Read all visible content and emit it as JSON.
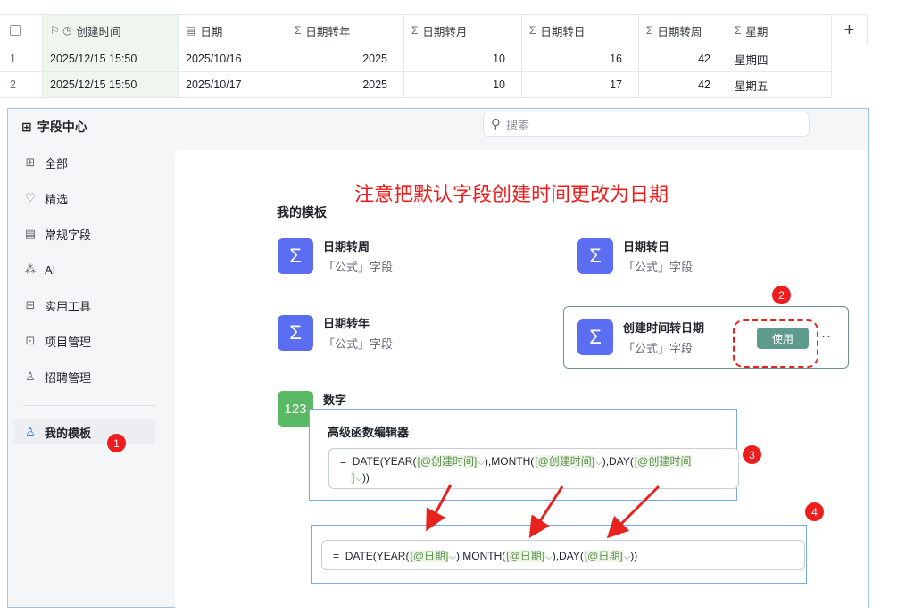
{
  "table": {
    "headers": [
      {
        "icon": "⚐ ◷",
        "label": "创建时间"
      },
      {
        "icon": "▤",
        "label": "日期"
      },
      {
        "icon": "Σ",
        "label": "日期转年"
      },
      {
        "icon": "Σ",
        "label": "日期转月"
      },
      {
        "icon": "Σ",
        "label": "日期转日"
      },
      {
        "icon": "Σ",
        "label": "日期转周"
      },
      {
        "icon": "Σ",
        "label": "星期"
      }
    ],
    "add_column": "+",
    "rows": [
      {
        "index": "1",
        "created": "2025/12/15 15:50",
        "date": "2025/10/16",
        "year": "2025",
        "month": "10",
        "day": "16",
        "week": "42",
        "weekday": "星期四"
      },
      {
        "index": "2",
        "created": "2025/12/15 15:50",
        "date": "2025/10/17",
        "year": "2025",
        "month": "10",
        "day": "17",
        "week": "42",
        "weekday": "星期五"
      }
    ]
  },
  "panel": {
    "title": "字段中心",
    "search_placeholder": "搜索",
    "nav": [
      {
        "label": "全部",
        "icon": "⊞"
      },
      {
        "label": "精选",
        "icon": "♡"
      },
      {
        "label": "常规字段",
        "icon": "▤"
      },
      {
        "label": "AI",
        "icon": "⁂"
      },
      {
        "label": "实用工具",
        "icon": "⊟"
      },
      {
        "label": "项目管理",
        "icon": "⊡"
      },
      {
        "label": "招聘管理",
        "icon": "♙"
      },
      {
        "label": "我的模板",
        "icon": "♙"
      }
    ],
    "notice": "注意把默认字段创建时间更改为日期",
    "section_title": "我的模板",
    "cards": [
      {
        "name": "日期转周",
        "sub": "「公式」字段",
        "icon": "Σ"
      },
      {
        "name": "日期转日",
        "sub": "「公式」字段",
        "icon": "Σ"
      },
      {
        "name": "日期转年",
        "sub": "「公式」字段",
        "icon": "Σ"
      },
      {
        "name": "创建时间转日期",
        "sub": "「公式」字段",
        "icon": "Σ"
      },
      {
        "name": "数字",
        "sub": "",
        "icon": "123"
      }
    ],
    "use_button": "使用",
    "more": "···"
  },
  "editor1": {
    "title": "高级函数编辑器",
    "formula": {
      "eq": "=",
      "p1": "DATE(YEAR(",
      "t1": "[@创建时间]",
      "p2": "),MONTH(",
      "t2": "[@创建时间]",
      "p3": "),DAY(",
      "t3a": "[@创建时间",
      "t3b": "]",
      "p4": "))"
    }
  },
  "editor2": {
    "formula": {
      "eq": "=",
      "p1": "DATE(YEAR(",
      "t1": "[@日期]",
      "p2": "),MONTH(",
      "t2": "[@日期]",
      "p3": "),DAY(",
      "t3": "[@日期]",
      "p4": "))"
    }
  },
  "badges": [
    "1",
    "2",
    "3",
    "4"
  ],
  "colors": {
    "accent": "#5b6df1",
    "use_button": "#5e9b8e",
    "annotation": "#ee1c1c",
    "number_tile": "#5ab964"
  }
}
